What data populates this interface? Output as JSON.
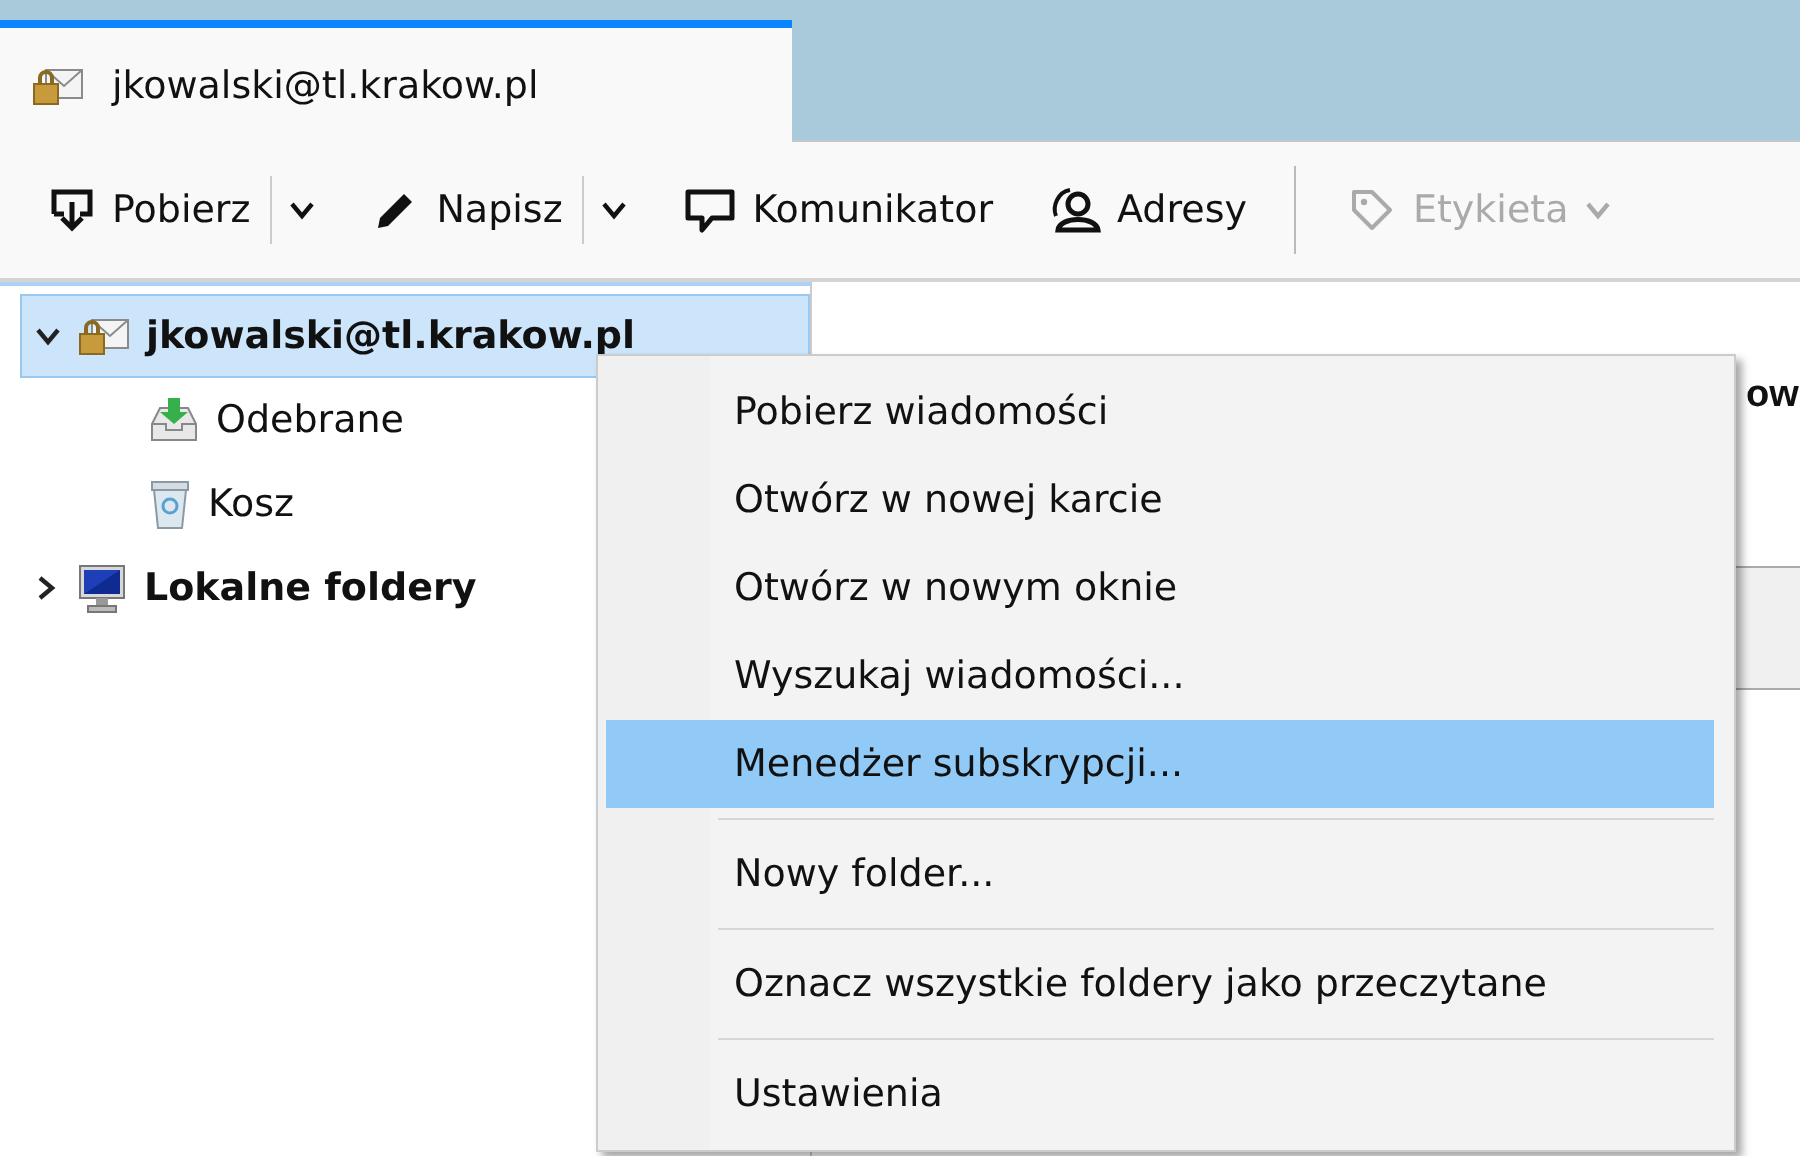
{
  "tabs": [
    {
      "label": "jkowalski@tl.krakow.pl",
      "kind": "account",
      "selected": true
    }
  ],
  "toolbar": [
    {
      "label": "Pobierz",
      "kind": "download",
      "dropdown": true,
      "disabled": false
    },
    {
      "label": "Napisz",
      "kind": "write",
      "dropdown": true,
      "disabled": false
    },
    {
      "label": "Komunikator",
      "kind": "chat",
      "dropdown": false,
      "disabled": false
    },
    {
      "label": "Adresy",
      "kind": "contacts",
      "dropdown": false,
      "disabled": false
    },
    {
      "kind": "separator"
    },
    {
      "label": "Etykieta",
      "kind": "tag",
      "dropdown": true,
      "disabled": true
    }
  ],
  "folders": [
    {
      "label": "jkowalski@tl.krakow.pl",
      "kind": "account",
      "expanded": true,
      "selected": true,
      "children": [
        {
          "label": "Odebrane",
          "kind": "inbox",
          "selected": false
        },
        {
          "label": "Kosz",
          "kind": "trash",
          "selected": false
        }
      ]
    },
    {
      "label": "Lokalne foldery",
      "kind": "local",
      "expanded": false,
      "selected": false
    }
  ],
  "content": {
    "heading": "ow"
  },
  "context_menu": [
    {
      "kind": "item",
      "label": "Pobierz wiadomości",
      "selected": false
    },
    {
      "kind": "item",
      "label": "Otwórz w nowej karcie",
      "selected": false
    },
    {
      "kind": "item",
      "label": "Otwórz w nowym oknie",
      "selected": false
    },
    {
      "kind": "item",
      "label": "Wyszukaj wiadomości...",
      "selected": false
    },
    {
      "kind": "item",
      "label": "Menedżer subskrypcji...",
      "selected": true
    },
    {
      "kind": "separator"
    },
    {
      "kind": "item",
      "label": "Nowy folder...",
      "selected": false
    },
    {
      "kind": "separator"
    },
    {
      "kind": "item",
      "label": "Oznacz wszystkie foldery jako przeczytane",
      "selected": false
    },
    {
      "kind": "separator"
    },
    {
      "kind": "item",
      "label": "Ustawienia",
      "selected": false
    }
  ]
}
